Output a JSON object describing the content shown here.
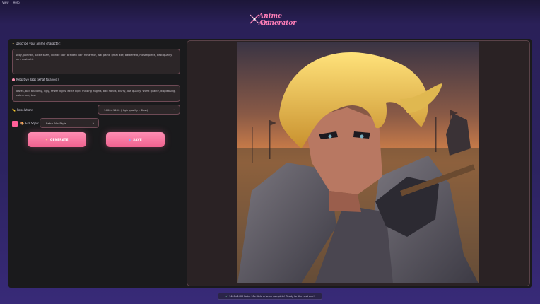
{
  "menubar": {
    "items": [
      {
        "label": "View"
      },
      {
        "label": "Help"
      }
    ]
  },
  "logo": {
    "line1": "Anime Art",
    "line2": "Generator"
  },
  "prompt": {
    "label": "Describe your anime character:",
    "value": "1boy, portrait, battle scars, blonde hair, braided hair, fur armor, war paint, great axe, battlefield, masterpiece, best quality, very aesthetic"
  },
  "negative": {
    "label": "Negative Tags (what to avoid):",
    "value": "lowres, bad anatomy, ugly, fewer digits, extra digit, missing fingers, bad hands, blurry, low quality, worst quality, displeasing, watermark, text"
  },
  "resolution": {
    "label": "Resolution:",
    "selected": "1400×1400 (High quality - Slow)"
  },
  "era_style": {
    "label": "Era Style:",
    "selected": "Retro 90s Style"
  },
  "buttons": {
    "generate": "GENERATE",
    "save": "SAVE"
  },
  "status": {
    "message": "1400×1400 Retro 90s Style artwork complete! Ready for the next one!"
  },
  "colors": {
    "accent": "#ff6f9f",
    "panel": "#1a1a1c",
    "field_border": "#6e4a55"
  },
  "icons": {
    "prompt": "sparkle-icon",
    "negative": "dot-icon",
    "resolution": "ruler-icon",
    "era": "palette-icon",
    "generate": "star-icon",
    "save": "disk-icon",
    "status": "check-icon"
  }
}
